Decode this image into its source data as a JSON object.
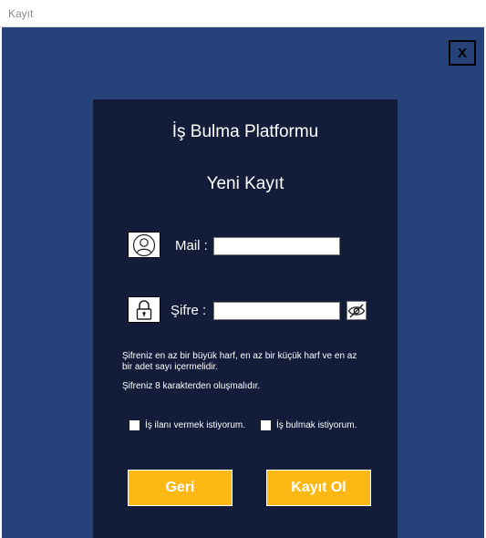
{
  "window": {
    "title": "Kayıt"
  },
  "close_button": {
    "label": "X"
  },
  "panel": {
    "platform_title": "İş Bulma Platformu",
    "form_title": "Yeni Kayıt",
    "mail": {
      "icon": "user-icon",
      "label": "Mail :",
      "value": ""
    },
    "password": {
      "icon": "lock-icon",
      "label": "Şifre :",
      "value": "",
      "toggle_icon": "eye-slash-icon"
    },
    "hints": [
      "Şifreniz en az bir büyük harf, en az bir küçük harf ve en az bir adet sayı içermelidir.",
      "Şifreniz 8 karakterden oluşmalıdır."
    ],
    "checkboxes": [
      {
        "label": "İş ilanı vermek istiyorum.",
        "checked": false
      },
      {
        "label": "İş bulmak istiyorum.",
        "checked": false
      }
    ],
    "buttons": {
      "back": "Geri",
      "register": "Kayıt Ol"
    }
  },
  "colors": {
    "background": "#27417a",
    "panel": "#131d3a",
    "button": "#fdb813",
    "text": "#ffffff"
  }
}
